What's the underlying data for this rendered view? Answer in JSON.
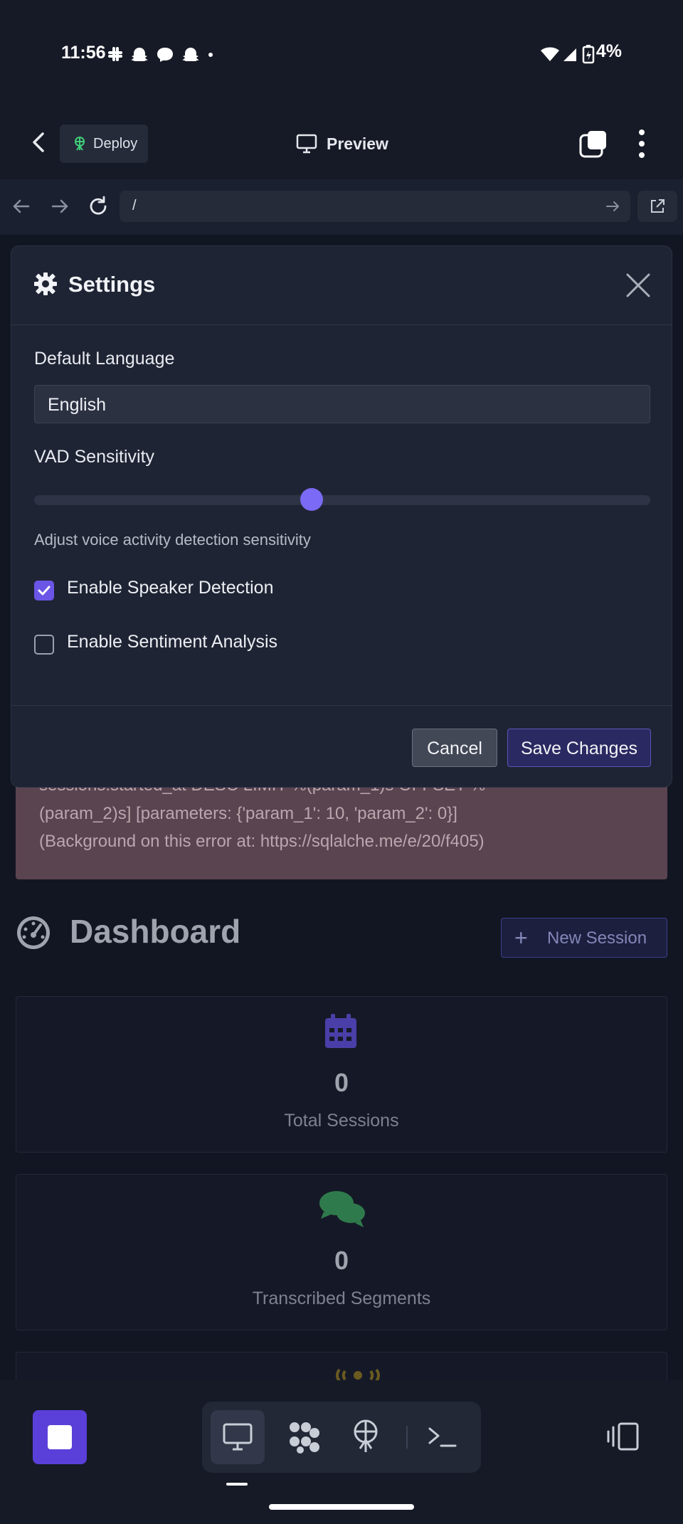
{
  "status_bar": {
    "time": "11:56",
    "notification_icons": [
      "slack-icon",
      "snapchat-icon",
      "messenger-icon",
      "snapchat-icon",
      "dot-icon"
    ],
    "battery": "4%"
  },
  "top_bar": {
    "deploy_label": "Deploy",
    "preview_label": "Preview"
  },
  "browser": {
    "url": "/"
  },
  "settings_modal": {
    "title": "Settings",
    "language_label": "Default Language",
    "language_value": "English",
    "vad_label": "VAD Sensitivity",
    "vad_value_fraction": 0.45,
    "vad_help": "Adjust voice activity detection sensitivity",
    "speaker_detection_label": "Enable Speaker Detection",
    "speaker_detection_checked": true,
    "sentiment_label": "Enable Sentiment Analysis",
    "sentiment_checked": false,
    "cancel_label": "Cancel",
    "save_label": "Save Changes"
  },
  "background_page": {
    "error_lines": [
      "sessions.started_at DESC LIMIT %(param_1)s OFFSET %",
      "(param_2)s] [parameters: {'param_1': 10, 'param_2': 0}]",
      "(Background on this error at: https://sqlalche.me/e/20/f405)"
    ],
    "dashboard_title": "Dashboard",
    "new_session_label": "New Session",
    "stats": [
      {
        "icon": "calendar-icon",
        "value": "0",
        "label": "Total Sessions"
      },
      {
        "icon": "comments-icon",
        "value": "0",
        "label": "Transcribed Segments"
      }
    ]
  },
  "colors": {
    "accent": "#6a55e6",
    "background": "#161a26",
    "modal_background": "#1f2434"
  }
}
